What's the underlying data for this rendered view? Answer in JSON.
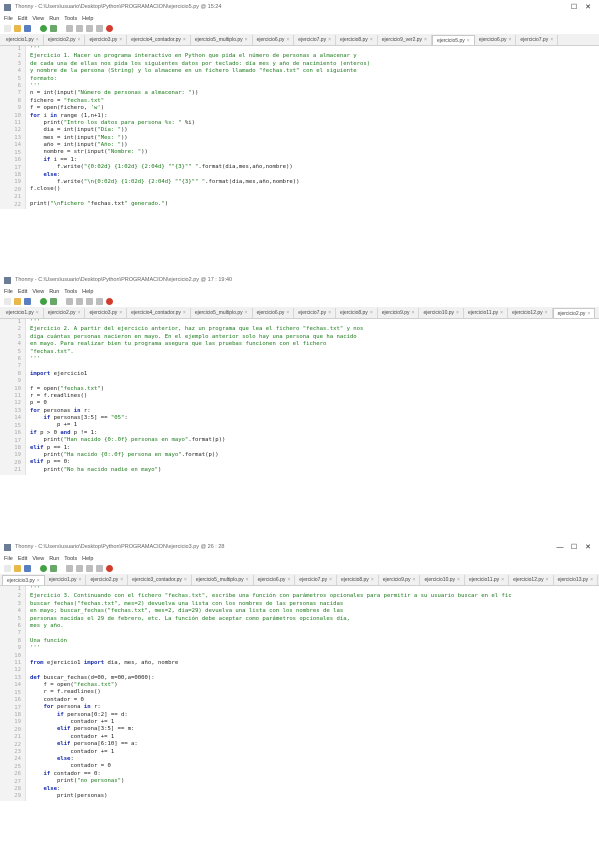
{
  "windows": [
    {
      "title": "Thonny - C:\\Users\\usuario\\Desktop\\Python\\PROGRAMACION\\ejercicio5.py @ 15:24",
      "menu": [
        "File",
        "Edit",
        "View",
        "Run",
        "Tools",
        "Help"
      ],
      "tabs": [
        "ejercicio1.py",
        "ejercicio2.py",
        "ejercicio3.py",
        "ejercicio4_contador.py",
        "ejercicio5_multiplo.py",
        "ejercicio6.py",
        "ejercicio7.py",
        "ejercicio8.py",
        "ejercicio9_ver2.py",
        "ejercicio5.py",
        "ejercicio6.py",
        "ejercicio7.py"
      ],
      "active_tab": 9,
      "lines": [
        "'''",
        "Ejercicio 1. Hacer un programa interactivo en Python que pida el número de personas a almacenar y",
        "de cada una de ellas nos pida los siguientes datos por teclado: día mes y año de nacimiento (enteros)",
        "y nombre de la persona (String) y lo almacene en un fichero llamado \"fechas.txt\" con el siguiente",
        "formato:",
        "'''",
        "n = int(input(\"Número de personas a almacenar: \"))",
        "fichero = \"fechas.txt\"",
        "f = open(fichero, 'w')",
        "for i in range (1,n+1):",
        "    print(\"Intro los datos para persona %s: \" %i)",
        "    dia = int(input(\"Día: \"))",
        "    mes = int(input(\"Mes: \"))",
        "    año = int(input(\"Año: \"))",
        "    nombre = str(input(\"Nombre: \"))",
        "    if i == 1:",
        "        f.write(\"{0:02d} {1:02d} {2:04d} \"\"{3}\"\" \".format(dia,mes,año,nombre))",
        "    else:",
        "        f.write(\"\\n{0:02d} {1:02d} {2:04d} \"\"{3}\"\" \".format(dia,mes,año,nombre))",
        "f.close()",
        "",
        "print(\"\\nFichero \"fechas.txt\" generado.\")"
      ]
    },
    {
      "title": "Thonny - C:\\Users\\usuario\\Desktop\\Python\\PROGRAMACION\\ejercicio2.py @ 17 : 19:40",
      "menu": [
        "File",
        "Edit",
        "View",
        "Run",
        "Tools",
        "Help"
      ],
      "tabs": [
        "ejercicio1.py",
        "ejercicio2.py",
        "ejercicio3.py",
        "ejercicio4_contador.py",
        "ejercicio5_multiplo.py",
        "ejercicio6.py",
        "ejercicio7.py",
        "ejercicio8.py",
        "ejercicio9.py",
        "ejercicio10.py",
        "ejercicio11.py",
        "ejercicio12.py",
        "ejercicio2.py"
      ],
      "active_tab": 12,
      "lines": [
        "'''",
        "Ejercicio 2. A partir del ejercicio anterior, haz un programa que lea el fichero \"fechas.txt\" y nos",
        "diga cuántas personas nacieron en mayo. En el ejemplo anterior solo hay una persona que ha nacido",
        "en mayo. Para realizar bien tu programa asegura que las pruebas funcionen con el fichero",
        "\"fechas.txt\".",
        "'''",
        "",
        "import ejercicio1",
        "",
        "f = open(\"fechas.txt\")",
        "r = f.readlines()",
        "p = 0",
        "for personas in r:",
        "    if personas[3:5] == \"05\":",
        "        p += 1",
        "if p > 0 and p != 1:",
        "    print(\"Han nacido {0:.0f} personas en mayo\".format(p))",
        "elif p == 1:",
        "    print(\"Ha nacido {0:.0f} persona en mayo\".format(p))",
        "elif p == 0:",
        "    print(\"No ha nacido nadie en mayo\")"
      ]
    },
    {
      "title": "Thonny - C:\\Users\\usuario\\Desktop\\Python\\PROGRAMACION\\ejercicio3.py @ 26 : 28",
      "menu": [
        "File",
        "Edit",
        "View",
        "Run",
        "Tools",
        "Help"
      ],
      "tabs": [
        "ejercicio3.py",
        "ejercicio1.py",
        "ejercicio2.py",
        "ejercicio3_contador.py",
        "ejercicio5_multiplo.py",
        "ejercicio6.py",
        "ejercicio7.py",
        "ejercicio8.py",
        "ejercicio9.py",
        "ejercicio10.py",
        "ejercicio11.py",
        "ejercicio12.py",
        "ejercicio13.py",
        "ejercicio14.py",
        "ejercicio2.py"
      ],
      "active_tab": 0,
      "lines": [
        "'''",
        "Ejercicio 3. Continuando con el fichero \"fechas.txt\", escribe una función con parámetros opcionales para permitir a su usuario buscar en el fic",
        "buscar fechas(\"fechas.txt\", mes=2) devuelva una lista con los nombres de las personas nacidas",
        "en mayo; buscar_fechas(\"fechas.txt\", mes=2, dia=29) devuelva una lista con los nombres de las",
        "personas nacidas el 29 de febrero, etc. La función debe aceptar como parámetros opcionales día,",
        "mes y año.",
        "",
        "Una función",
        "'''",
        "",
        "from ejercicio1 import dia, mes, año, nombre",
        "",
        "def buscar_fechas(d=00, m=00,a=0000):",
        "    f = open(\"fechas.txt\")",
        "    r = f.readlines()",
        "    contador = 0",
        "    for persona in r:",
        "        if persona[0:2] == d:",
        "            contador += 1",
        "        elif persona[3:5] == m:",
        "            contador += 1",
        "        elif persona[6:10] == a:",
        "            contador += 1",
        "        else:",
        "            contador = 0",
        "    if contador == 0:",
        "        print(\"no personas\")",
        "    else:",
        "        print(personas)"
      ]
    }
  ],
  "window_controls": {
    "minimize": "—",
    "maximize": "☐",
    "close": "✕"
  },
  "colors": {
    "keyword": "#1a2fb0",
    "string": "#1a7a1a",
    "gutter_bg": "#f3f3f3",
    "tab_bar": "#f1f1f1"
  },
  "toolbar_icons": [
    "new-file-icon",
    "open-file-icon",
    "save-icon",
    "run-icon",
    "debug-icon",
    "step-over-icon",
    "step-into-icon",
    "step-out-icon",
    "resume-icon",
    "stop-icon"
  ]
}
